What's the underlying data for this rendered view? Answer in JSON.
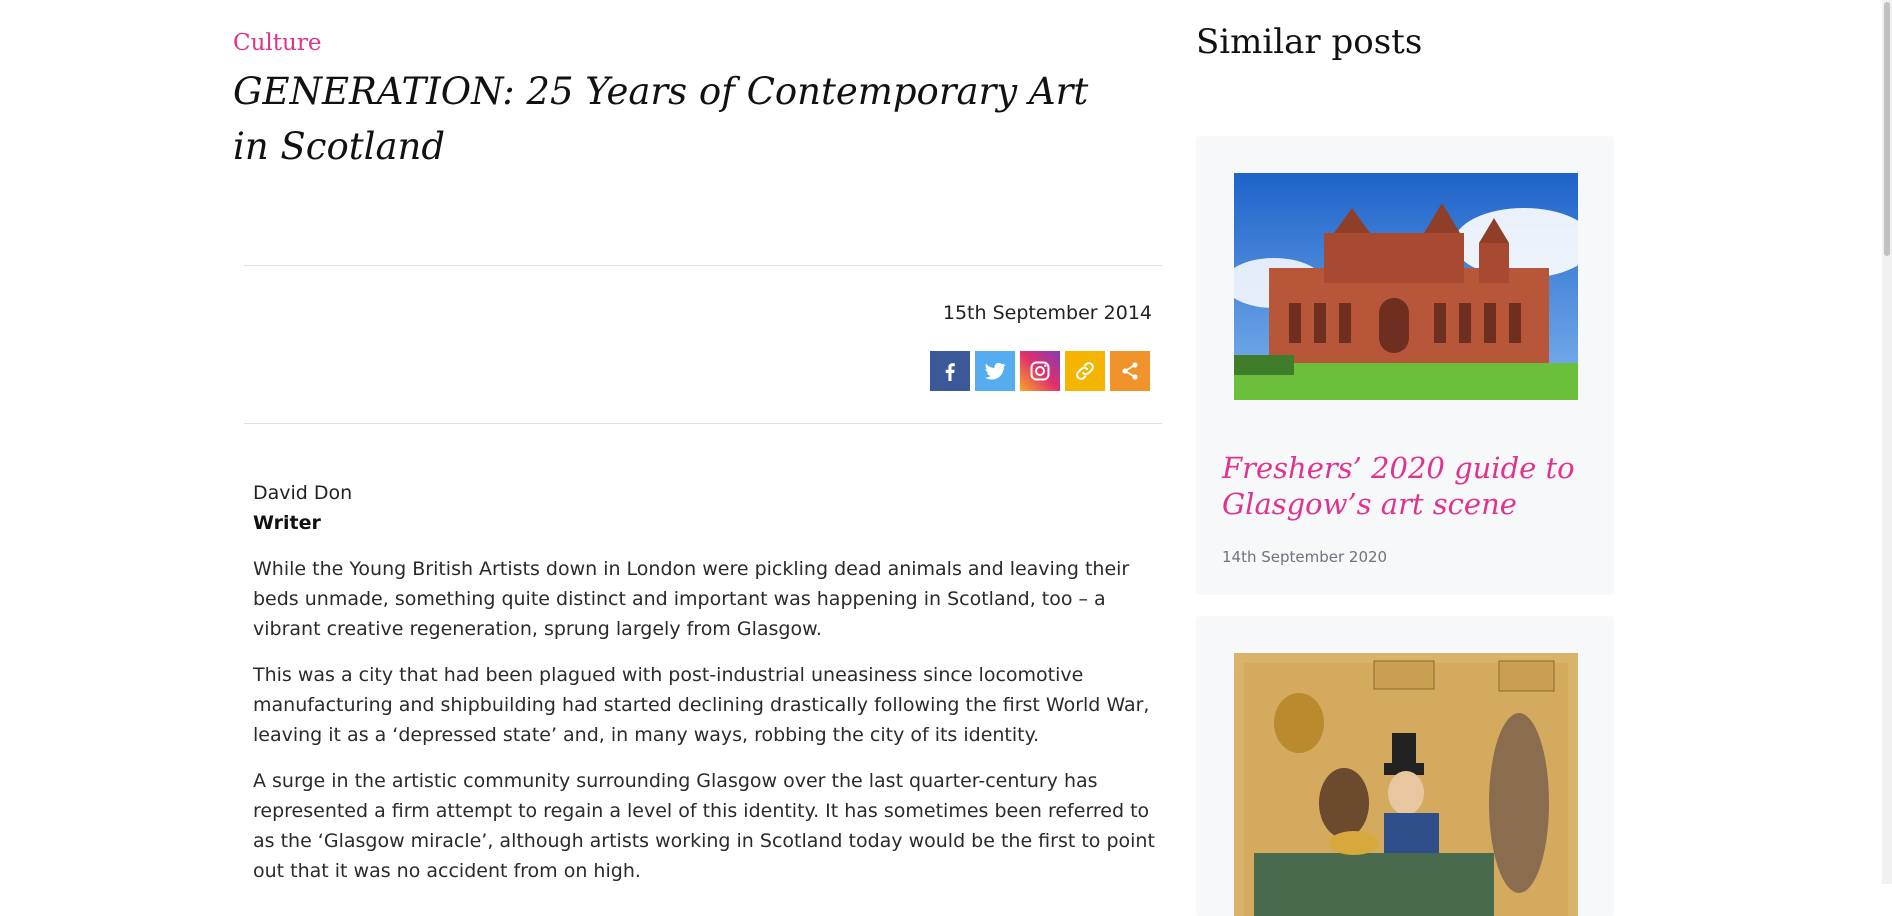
{
  "article": {
    "category": "Culture",
    "title": "GENERATION: 25 Years of Contemporary Art in Scotland",
    "date": "15th September 2014",
    "author": "David Don",
    "author_role": "Writer",
    "paragraphs": [
      "While the Young British Artists down in London were pickling dead animals and leaving their beds unmade, something quite distinct and important was happening in Scotland, too – a vibrant creative regeneration, sprung largely from Glasgow.",
      "This was a city that had been plagued with post-industrial uneasiness since locomotive manufacturing and shipbuilding had started declining drastically following the first World War, leaving it as a ‘depressed state’ and, in many ways, robbing the city of its identity.",
      "A surge in the artistic community surrounding Glasgow over the last quarter-century has represented a firm attempt to regain a level of this identity. It has sometimes been referred to as the ‘Glasgow miracle’, although artists working in Scotland today would be the first to point out that it was no accident from on high."
    ]
  },
  "share": {
    "buttons": [
      {
        "icon": "facebook-icon",
        "color": "#3b5998"
      },
      {
        "icon": "twitter-icon",
        "color": "#55acee"
      },
      {
        "icon": "instagram-icon",
        "color": "#c13584"
      },
      {
        "icon": "copy-link-icon",
        "color": "#f5b400"
      },
      {
        "icon": "share-icon",
        "color": "#f0932b"
      }
    ]
  },
  "sidebar": {
    "title": "Similar posts",
    "posts": [
      {
        "title": "Freshers’ 2020 guide to Glasgow’s art scene",
        "date": "14th September 2020"
      }
    ]
  },
  "colors": {
    "accent": "#e0338f",
    "rule": "#e1e1e1",
    "card_bg": "#f7f8fa"
  }
}
